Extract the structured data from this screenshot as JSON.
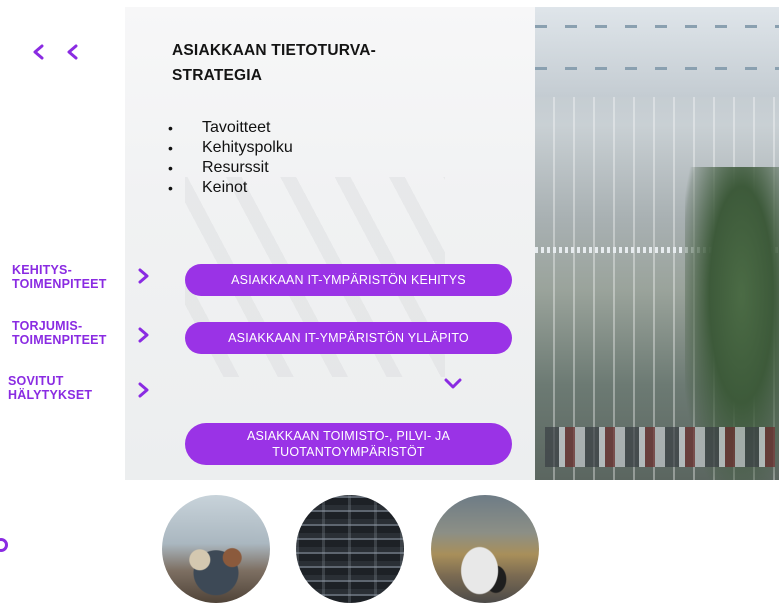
{
  "header": {
    "title_line1": "ASIAKKAAN TIETOTURVA-",
    "title_line2": "STRATEGIA"
  },
  "bullets": [
    "Tavoitteet",
    "Kehityspolku",
    "Resurssit",
    "Keinot"
  ],
  "side_nav": [
    {
      "line1": "KEHITYS-",
      "line2": "TOIMENPITEET"
    },
    {
      "line1": "TORJUMIS-",
      "line2": "TOIMENPITEET"
    },
    {
      "line1": "SOVITUT",
      "line2": "HÄLYTYKSET"
    }
  ],
  "buttons": {
    "development": "ASIAKKAAN IT-YMPÄRISTÖN KEHITYS",
    "maintenance": "ASIAKKAAN IT-YMPÄRISTÖN YLLÄPITO",
    "environments_line1": "ASIAKKAAN TOIMISTO-, PILVI- JA",
    "environments_line2": "TUOTANTOYMPÄRISTÖT"
  },
  "icons": {
    "back": "chevron-left-icon",
    "side_item": "chevron-right-icon",
    "expand": "chevron-down-icon"
  },
  "colors": {
    "accent": "#9a33e6",
    "accent_text": "#8a2be2"
  }
}
